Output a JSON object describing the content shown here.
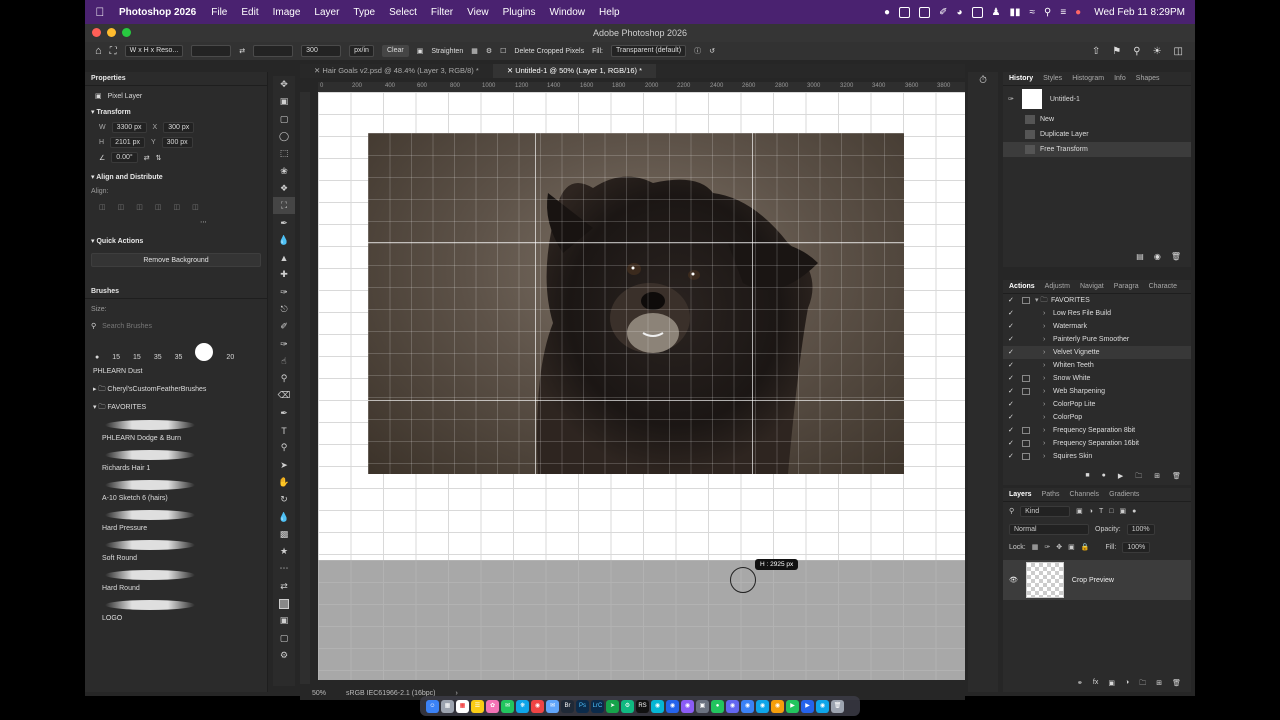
{
  "menubar": {
    "app_name": "Photoshop 2026",
    "items": [
      "File",
      "Edit",
      "Image",
      "Layer",
      "Type",
      "Select",
      "Filter",
      "View",
      "Plugins",
      "Window",
      "Help"
    ],
    "clock": "Wed Feb 11  8:29PM"
  },
  "window": {
    "title": "Adobe Photoshop 2026"
  },
  "options_bar": {
    "ratio_preset": "W x H x Reso...",
    "resolution_value": "300",
    "resolution_unit": "px/in",
    "clear_label": "Clear",
    "straighten_label": "Straighten",
    "delete_cropped_label": "Delete Cropped Pixels",
    "fill_label": "Fill:",
    "fill_value": "Transparent (default)"
  },
  "properties": {
    "tab_label": "Properties",
    "layer_kind": "Pixel Layer",
    "transform_title": "Transform",
    "w_label": "W",
    "w_value": "3300 px",
    "x_label": "X",
    "x_value": "300 px",
    "h_label": "H",
    "h_value": "2101 px",
    "y_label": "Y",
    "y_value": "300 px",
    "angle_value": "0.00°",
    "align_title": "Align and Distribute",
    "align_label": "Align:",
    "quick_actions_title": "Quick Actions",
    "remove_bg_label": "Remove Background"
  },
  "brushes": {
    "tab_label": "Brushes",
    "size_label": "Size:",
    "search_placeholder": "Search Brushes",
    "preset_sizes": [
      "15",
      "15",
      "35",
      "35",
      "20"
    ],
    "group_phlearn": "PHLEARN Dust",
    "folder_cheryl": "Cheryl'sCustomFeatherBrushes",
    "folder_favorites": "FAVORITES",
    "items": [
      "PHLEARN Dodge & Burn",
      "Richards Hair 1",
      "A-10 Sketch 6 (hairs)",
      "Hard Pressure",
      "Soft Round",
      "Hard Round",
      "LOGO"
    ]
  },
  "documents": {
    "tabs": [
      "Hair Goals v2.psd @ 48.4% (Layer 3, RGB/8) *",
      "Untitled-1 @ 50% (Layer 1, RGB/16) *"
    ],
    "active_index": 1,
    "ruler_ticks": [
      "0",
      "200",
      "400",
      "600",
      "800",
      "1000",
      "1200",
      "1400",
      "1600",
      "1800",
      "2000",
      "2200",
      "2400",
      "2600",
      "2800",
      "3000",
      "3200",
      "3400",
      "3600",
      "3800"
    ],
    "crop_readout": "H : 2925 px"
  },
  "status_bar": {
    "zoom": "50%",
    "profile": "sRGB IEC61966-2.1 (16bpc)"
  },
  "history": {
    "tabs": [
      "History",
      "Styles",
      "Histogram",
      "Info",
      "Shapes"
    ],
    "snapshot": "Untitled-1",
    "items": [
      "New",
      "Duplicate Layer",
      "Free Transform"
    ],
    "selected_index": 2
  },
  "actions": {
    "tabs": [
      "Actions",
      "Adjustm",
      "Navigat",
      "Paragra",
      "Characte"
    ],
    "folder": "FAVORITES",
    "items": [
      {
        "name": "Low Res File Build",
        "dialog": false
      },
      {
        "name": "Watermark",
        "dialog": false
      },
      {
        "name": "Painterly Pure Smoother",
        "dialog": false
      },
      {
        "name": "Velvet Vignette",
        "dialog": false
      },
      {
        "name": "Whiten Teeth",
        "dialog": false
      },
      {
        "name": "Snow White",
        "dialog": true
      },
      {
        "name": "Web Sharpening",
        "dialog": true
      },
      {
        "name": "ColorPop Lite",
        "dialog": false
      },
      {
        "name": "ColorPop",
        "dialog": false
      },
      {
        "name": "Frequency Separation 8bit",
        "dialog": true
      },
      {
        "name": "Frequency Separation 16bit",
        "dialog": true
      },
      {
        "name": "Squires Skin",
        "dialog": true
      }
    ],
    "highlighted_index": 3
  },
  "layers": {
    "tabs": [
      "Layers",
      "Paths",
      "Channels",
      "Gradients"
    ],
    "filter_kind": "Kind",
    "blend_mode": "Normal",
    "opacity_label": "Opacity:",
    "opacity_value": "100%",
    "lock_label": "Lock:",
    "fill_label": "Fill:",
    "fill_value": "100%",
    "layer_name": "Crop Preview"
  },
  "colors": {
    "menubar": "#4a2270",
    "panel": "#2b2b2b",
    "accent_selected": "#3c3c3c"
  }
}
